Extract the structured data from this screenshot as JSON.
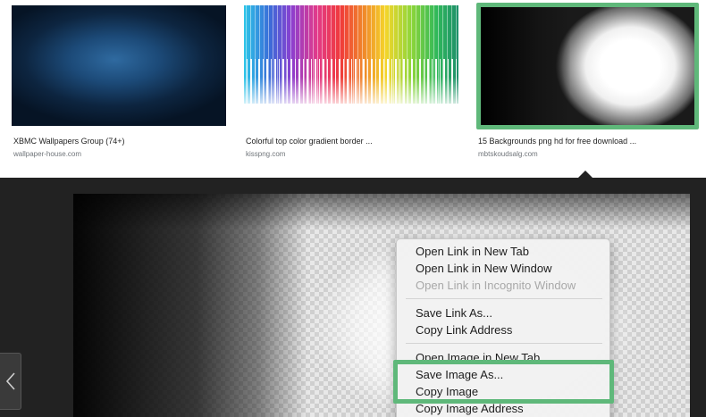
{
  "results": [
    {
      "title": "XBMC Wallpapers Group (74+)",
      "source": "wallpaper-house.com"
    },
    {
      "title": "Colorful top color gradient border ...",
      "source": "kisspng.com"
    },
    {
      "title": "15 Backgrounds png hd for free download ...",
      "source": "mbtskoudsalg.com"
    }
  ],
  "selected_result_index": 2,
  "accent_color": "#5fb87a",
  "nav": {
    "prev_icon": "chevron-left-icon"
  },
  "context_menu": {
    "items": [
      {
        "label": "Open Link in New Tab",
        "enabled": true
      },
      {
        "label": "Open Link in New Window",
        "enabled": true
      },
      {
        "label": "Open Link in Incognito Window",
        "enabled": false
      },
      {
        "label": "Save Link As...",
        "enabled": true
      },
      {
        "label": "Copy Link Address",
        "enabled": true
      },
      {
        "label": "Open Image in New Tab",
        "enabled": true
      },
      {
        "label": "Save Image As...",
        "enabled": true
      },
      {
        "label": "Copy Image",
        "enabled": true
      },
      {
        "label": "Copy Image Address",
        "enabled": true
      }
    ],
    "highlighted_items": [
      "Save Image As...",
      "Copy Image"
    ]
  }
}
